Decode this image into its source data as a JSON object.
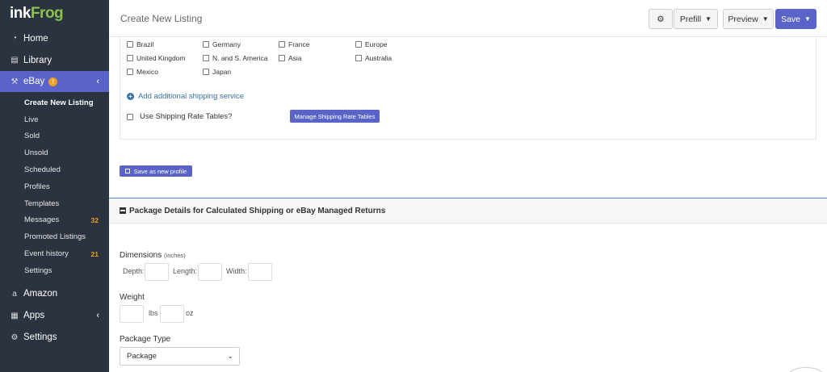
{
  "brand": {
    "part1": "ink",
    "part2": "Frog"
  },
  "nav": {
    "home": "Home",
    "library": "Library",
    "ebay": "eBay",
    "ebay_badge": "!",
    "amazon": "Amazon",
    "apps": "Apps",
    "settings": "Settings"
  },
  "ebay_sub": [
    {
      "label": "Create New Listing"
    },
    {
      "label": "Live"
    },
    {
      "label": "Sold"
    },
    {
      "label": "Unsold"
    },
    {
      "label": "Scheduled"
    },
    {
      "label": "Profiles"
    },
    {
      "label": "Templates"
    },
    {
      "label": "Messages",
      "count": "32"
    },
    {
      "label": "Promoted Listings"
    },
    {
      "label": "Event history",
      "count": "21"
    },
    {
      "label": "Settings"
    }
  ],
  "header": {
    "title": "Create New Listing",
    "prefill": "Prefill",
    "preview": "Preview",
    "save": "Save"
  },
  "locations": [
    "Brazil",
    "Germany",
    "France",
    "Europe",
    "United Kingdom",
    "N. and S. America",
    "Asia",
    "Australia",
    "Mexico",
    "Japan"
  ],
  "shipping": {
    "add_service": "Add additional shipping service",
    "use_rate_tables": "Use Shipping Rate Tables?",
    "manage_rate_tables": "Manage Shipping Rate Tables",
    "save_profile": "Save as new profile"
  },
  "package": {
    "section_title": "Package Details for Calculated Shipping or eBay Managed Returns",
    "dimensions_label": "Dimensions",
    "dimensions_unit": "(inches)",
    "depth": "Depth:",
    "length": "Length:",
    "width": "Width:",
    "weight_label": "Weight",
    "lbs": "lbs",
    "oz": "oz",
    "package_type_label": "Package Type",
    "package_type_value": "Package"
  },
  "colors": {
    "sidebar": "#2b3240",
    "accent": "#5a64c8",
    "badge": "#f0a020",
    "link": "#3a6fa6"
  }
}
